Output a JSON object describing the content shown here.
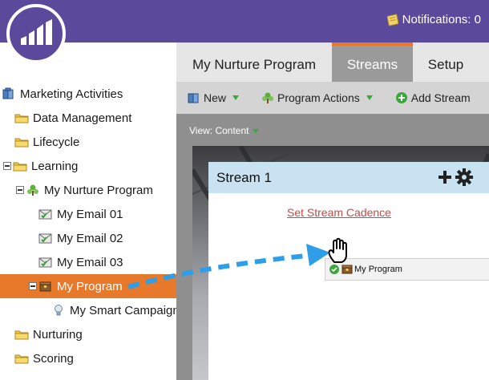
{
  "header": {
    "notifications_label": "Notifications: 0",
    "brand_color": "#5b4a9b",
    "accent_color": "#e8782a"
  },
  "sidebar": {
    "tree": [
      {
        "label": "Marketing Activities",
        "icon": "marketing-activities-icon",
        "level": 0
      },
      {
        "label": "Data Management",
        "icon": "folder-icon",
        "level": 1
      },
      {
        "label": "Lifecycle",
        "icon": "folder-icon",
        "level": 1
      },
      {
        "label": "Learning",
        "icon": "folder-icon",
        "level": 0,
        "expanded": true
      },
      {
        "label": "My Nurture Program",
        "icon": "nurture-program-icon",
        "level": 1,
        "expanded": true
      },
      {
        "label": "My Email 01",
        "icon": "email-icon",
        "level": 2
      },
      {
        "label": "My Email 02",
        "icon": "email-icon",
        "level": 2
      },
      {
        "label": "My Email 03",
        "icon": "email-icon",
        "level": 2
      },
      {
        "label": "My Program",
        "icon": "program-icon",
        "level": 1,
        "selected": true
      },
      {
        "label": "My Smart Campaign",
        "icon": "smart-campaign-icon",
        "level": 2
      },
      {
        "label": "Nurturing",
        "icon": "folder-icon",
        "level": 0
      },
      {
        "label": "Scoring",
        "icon": "folder-icon",
        "level": 0
      }
    ]
  },
  "tabs": [
    {
      "label": "My Nurture Program",
      "active": false
    },
    {
      "label": "Streams",
      "active": true
    },
    {
      "label": "Setup",
      "active": false
    }
  ],
  "toolbar": {
    "new_label": "New",
    "program_actions_label": "Program Actions",
    "add_stream_label": "Add Stream"
  },
  "view": {
    "label": "View: Content"
  },
  "stream": {
    "title": "Stream 1",
    "cadence_link": "Set Stream Cadence",
    "dragged_item": "My Program"
  }
}
